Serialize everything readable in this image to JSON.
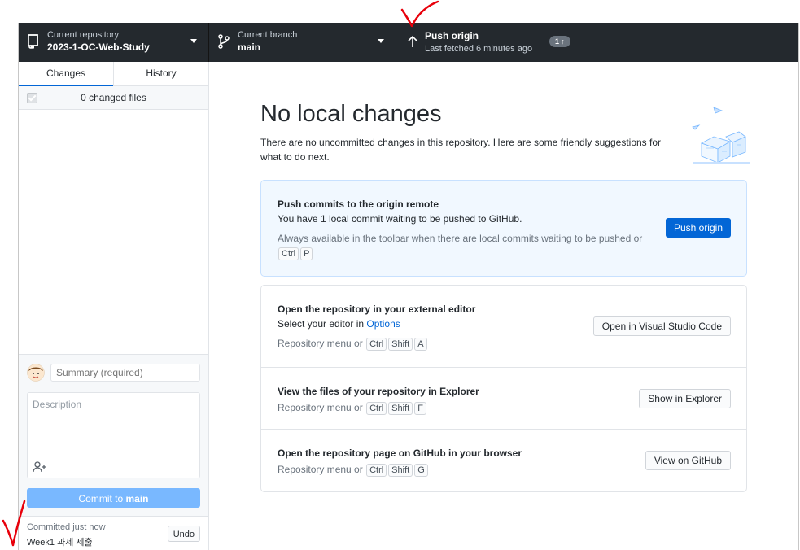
{
  "toolbar": {
    "repo": {
      "label": "Current repository",
      "value": "2023-1-OC-Web-Study"
    },
    "branch": {
      "label": "Current branch",
      "value": "main"
    },
    "push": {
      "label": "Push origin",
      "sub": "Last fetched 6 minutes ago",
      "badge": "1 ↑"
    }
  },
  "sidebar": {
    "tabs": [
      {
        "label": "Changes"
      },
      {
        "label": "History"
      }
    ],
    "changed_files": "0 changed files",
    "summary_placeholder": "Summary (required)",
    "description_placeholder": "Description",
    "commit_prefix": "Commit to ",
    "commit_branch": "main",
    "undo": {
      "label": "Committed just now",
      "message": "Week1 과제 제출",
      "button": "Undo"
    }
  },
  "main": {
    "title": "No local changes",
    "intro": "There are no uncommitted changes in this repository. Here are some friendly suggestions for what to do next.",
    "push_card": {
      "title": "Push commits to the origin remote",
      "desc": "You have 1 local commit waiting to be pushed to GitHub.",
      "hint": "Always available in the toolbar when there are local commits waiting to be pushed or",
      "keys": [
        "Ctrl",
        "P"
      ],
      "button": "Push origin"
    },
    "actions": [
      {
        "title": "Open the repository in your external editor",
        "desc_prefix": "Select your editor in ",
        "desc_link": "Options",
        "hint": "Repository menu or",
        "keys": [
          "Ctrl",
          "Shift",
          "A"
        ],
        "button": "Open in Visual Studio Code"
      },
      {
        "title": "View the files of your repository in Explorer",
        "hint": "Repository menu or",
        "keys": [
          "Ctrl",
          "Shift",
          "F"
        ],
        "button": "Show in Explorer"
      },
      {
        "title": "Open the repository page on GitHub in your browser",
        "hint": "Repository menu or",
        "keys": [
          "Ctrl",
          "Shift",
          "G"
        ],
        "button": "View on GitHub"
      }
    ]
  },
  "colors": {
    "toolbar_bg": "#24292e",
    "primary": "#0366d6",
    "commit_disabled": "#79b8ff",
    "annotation": "#e8000b"
  },
  "icons": [
    "repo-icon",
    "branch-icon",
    "arrow-up-icon",
    "caret-down-icon",
    "checkbox-icon",
    "avatar-icon",
    "add-coauthor-icon",
    "checkmark-annotation-icon"
  ]
}
